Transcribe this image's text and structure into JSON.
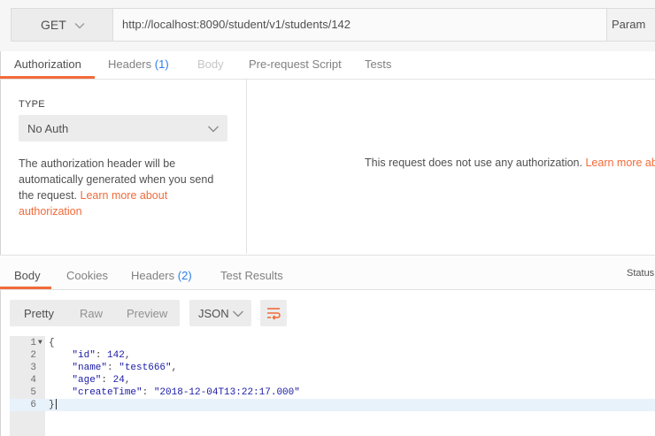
{
  "request": {
    "method": "GET",
    "url": "http://localhost:8090/student/v1/students/142",
    "params_label": "Param"
  },
  "request_tabs": [
    {
      "label": "Authorization",
      "active": true
    },
    {
      "label": "Headers",
      "count": "(1)"
    },
    {
      "label": "Body",
      "disabled": true
    },
    {
      "label": "Pre-request Script"
    },
    {
      "label": "Tests"
    }
  ],
  "auth": {
    "type_label": "TYPE",
    "selected": "No Auth",
    "description": "The authorization header will be automatically generated when you send the request. ",
    "learn_more_link": "Learn more about authorization",
    "message": "This request does not use any authorization. ",
    "message_link": "Learn more ab"
  },
  "response_tabs": [
    {
      "label": "Body",
      "active": true
    },
    {
      "label": "Cookies"
    },
    {
      "label": "Headers",
      "count": "(2)"
    },
    {
      "label": "Test Results"
    }
  ],
  "status_label": "Status",
  "format": {
    "modes": [
      "Pretty",
      "Raw",
      "Preview"
    ],
    "active_mode": "Pretty",
    "language": "JSON"
  },
  "response_body": {
    "line_numbers": [
      "1",
      "2",
      "3",
      "4",
      "5",
      "6"
    ],
    "open_brace": "{",
    "close_brace": "}",
    "fields": [
      {
        "key": "\"id\"",
        "value": "142"
      },
      {
        "key": "\"name\"",
        "value": "\"test666\""
      },
      {
        "key": "\"age\"",
        "value": "24"
      },
      {
        "key": "\"createTime\"",
        "value": "\"2018-12-04T13:22:17.000\""
      }
    ]
  },
  "colors": {
    "accent": "#f26b3a",
    "count_blue": "#2b7de9",
    "json_value": "#1a1aa6"
  },
  "icons": {
    "method_dropdown": "chevron-down-icon",
    "auth_dropdown": "chevron-down-icon",
    "language_dropdown": "chevron-down-icon",
    "wrap": "wrap-lines-icon",
    "fold": "fold-triangle-icon"
  }
}
